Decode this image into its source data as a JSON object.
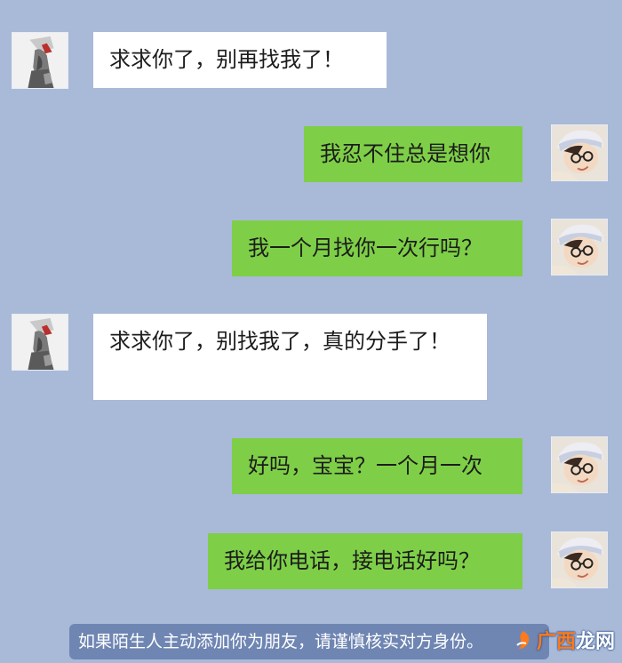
{
  "messages": [
    {
      "side": "in",
      "text": "求求你了，别再找我了！"
    },
    {
      "side": "out",
      "text": "我忍不住总是想你"
    },
    {
      "side": "out",
      "text": "我一个月找你一次行吗？"
    },
    {
      "side": "in",
      "text": "求求你了，别找我了，真的分手了！"
    },
    {
      "side": "out",
      "text": "好吗，宝宝？一个月一次"
    },
    {
      "side": "out",
      "text": "我给你电话，接电话好吗？"
    }
  ],
  "notice": "如果陌生人主动添加你为朋友，请谨慎核实对方身份。",
  "watermark": {
    "part1": "广西",
    "part2": "龙网"
  },
  "colors": {
    "background": "#a9b9d8",
    "incoming_bubble": "#ffffff",
    "outgoing_bubble": "#7ecf47",
    "notice_bg": "#6f86b3"
  }
}
